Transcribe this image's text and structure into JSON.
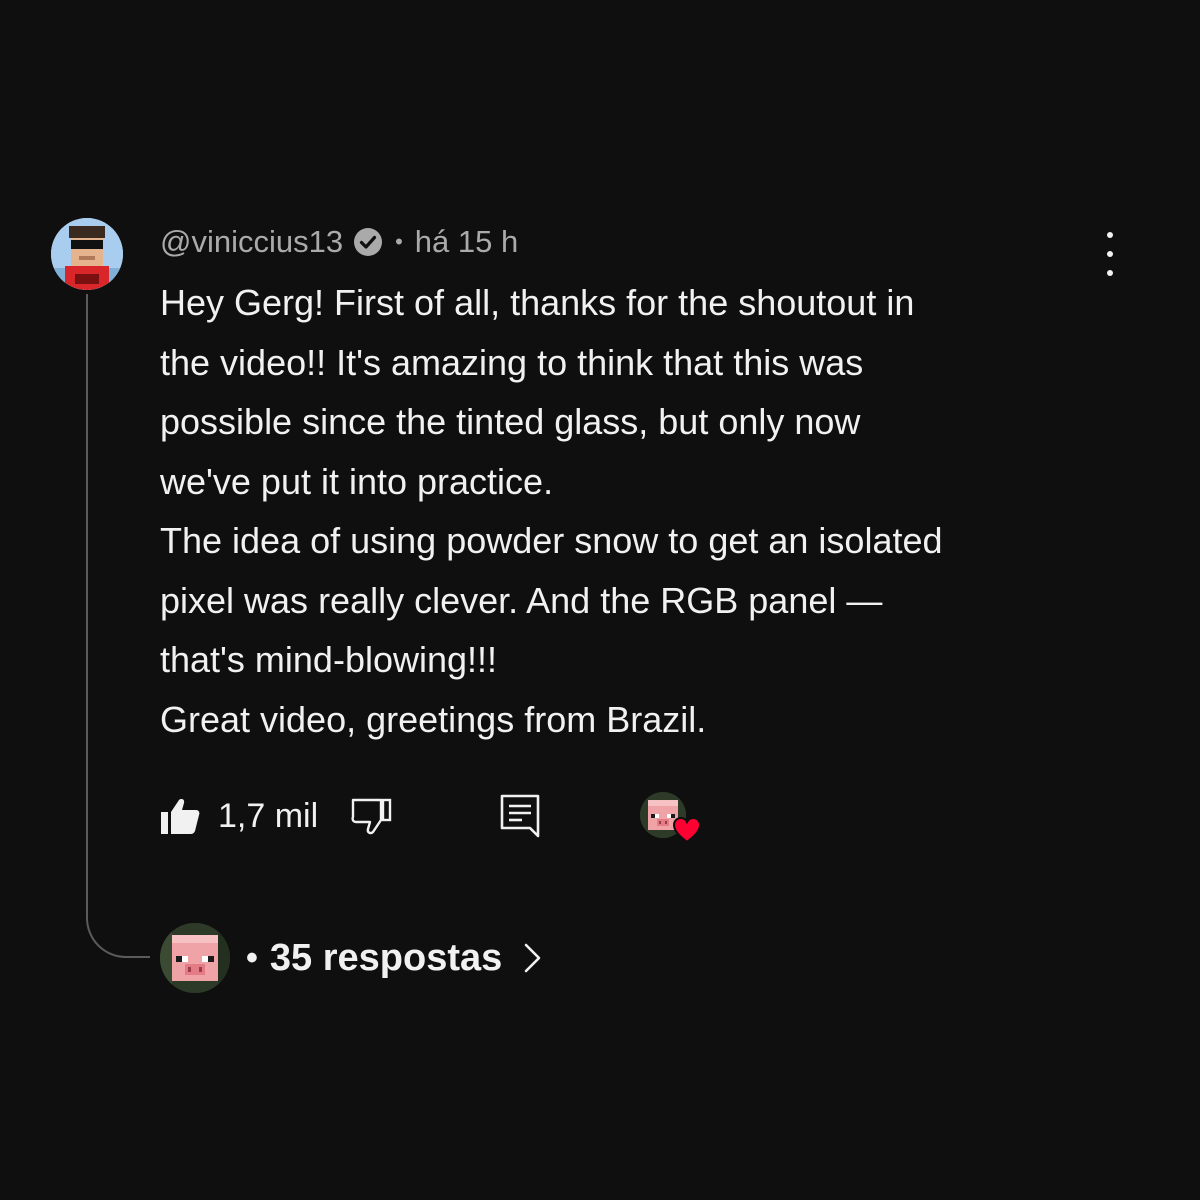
{
  "comment": {
    "author": "@viniccius13",
    "separator": "•",
    "time": "há 15 h",
    "lines": [
      "Hey Gerg! First of all, thanks for the shoutout in",
      "the video!! It's amazing to think that this was",
      "possible since the tinted glass, but only now",
      "we've put it into practice.",
      "The idea of using powder snow to get an isolated",
      "pixel was really clever. And the RGB panel —",
      "that's mind-blowing!!!",
      "Great video, greetings from Brazil."
    ]
  },
  "actions": {
    "like_count": "1,7 mil"
  },
  "replies": {
    "dot": "•",
    "label": "35 respostas"
  },
  "colors": {
    "background": "#0f0f0f",
    "text": "#f1f1f1",
    "secondary_text": "#aaaaaa",
    "heart": "#ff0033"
  },
  "icons": [
    "verified-icon",
    "more-vert-icon",
    "like-icon",
    "dislike-icon",
    "reply-icon",
    "heart-icon",
    "chevron-right-icon"
  ]
}
